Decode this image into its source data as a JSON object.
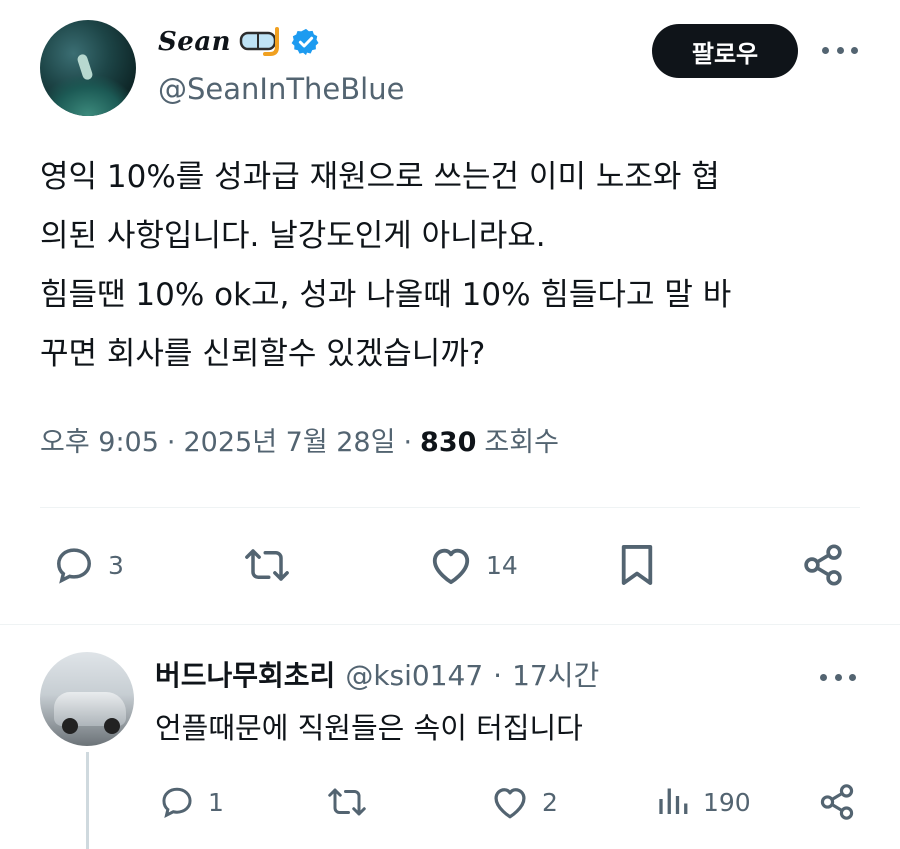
{
  "tweet": {
    "author": {
      "display_name": "Sean",
      "handle": "@SeanInTheBlue"
    },
    "follow_label": "팔로우",
    "text": "영익 10%를 성과급 재원으로 쓰는건 이미 노조와 협\n의된 사항입니다. 날강도인게 아니라요.\n힘들땐 10% ok고, 성과 나올때 10% 힘들다고 말 바\n꾸면 회사를 신뢰할수 있겠습니까?",
    "meta": {
      "time": "오후 9:05",
      "separator": "·",
      "date": "2025년 7월 28일",
      "views_count": "830",
      "views_label": "조회수"
    },
    "actions": {
      "replies": "3",
      "likes": "14"
    }
  },
  "reply": {
    "author_name": "버드나무회초리",
    "handle": "@ksi0147",
    "separator": "·",
    "time": "17시간",
    "text": "언플때문에 직원들은 속이 터집니다",
    "actions": {
      "replies": "1",
      "likes": "2",
      "views": "190"
    }
  },
  "icons": {
    "verified": "verified-badge-icon",
    "mask": "snorkel-mask-emoji-icon",
    "reply": "reply-icon",
    "retweet": "retweet-icon",
    "like": "heart-icon",
    "bookmark": "bookmark-icon",
    "share": "share-icon",
    "views": "views-chart-icon",
    "more": "more-icon"
  },
  "colors": {
    "text_primary": "#0f1419",
    "text_secondary": "#536471",
    "verified_blue": "#1d9bf0",
    "follow_button_bg": "#0f1419",
    "divider": "#eff3f4"
  }
}
